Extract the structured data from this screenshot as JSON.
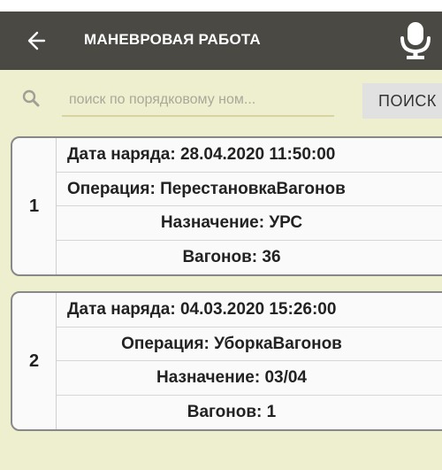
{
  "appbar": {
    "back_icon": "arrow-left-icon",
    "title": "МАНЕВРОВАЯ РАБОТА",
    "mic_icon": "microphone-icon"
  },
  "search": {
    "icon": "search-icon",
    "placeholder": "поиск по порядковому ном...",
    "button_label": "ПОИСК"
  },
  "colors": {
    "appbar_bg": "#4b4943",
    "page_bg": "#eeefcf",
    "card_bg": "#fafafa",
    "card_border": "#888888"
  },
  "cards": [
    {
      "number": "1",
      "date_label": "Дата наряда: ",
      "date_value": "28.04.2020 11:50:00",
      "operation_label": "Операция: ",
      "operation_value": "ПерестановкаВагонов",
      "destination_label": "Назначение: ",
      "destination_value": "УРС",
      "wagons_label": "Вагонов: ",
      "wagons_value": "36"
    },
    {
      "number": "2",
      "date_label": "Дата наряда: ",
      "date_value": "04.03.2020 15:26:00",
      "operation_label": "Операция: ",
      "operation_value": "УборкаВагонов",
      "destination_label": "Назначение: ",
      "destination_value": "03/04",
      "wagons_label": "Вагонов: ",
      "wagons_value": "1"
    }
  ]
}
